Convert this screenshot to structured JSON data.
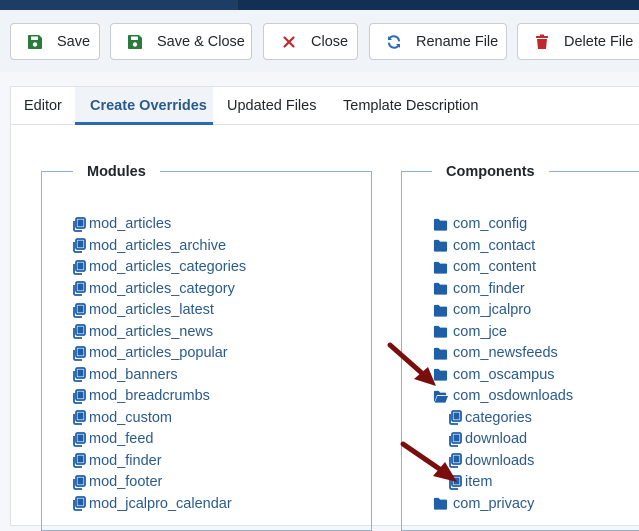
{
  "toolbar": {
    "save": "Save",
    "save_close": "Save & Close",
    "close": "Close",
    "rename": "Rename File",
    "delete": "Delete File"
  },
  "tabs": [
    "Editor",
    "Create Overrides",
    "Updated Files",
    "Template Description"
  ],
  "modules": {
    "title": "Modules",
    "items": [
      "mod_articles",
      "mod_articles_archive",
      "mod_articles_categories",
      "mod_articles_category",
      "mod_articles_latest",
      "mod_articles_news",
      "mod_articles_popular",
      "mod_banners",
      "mod_breadcrumbs",
      "mod_custom",
      "mod_feed",
      "mod_finder",
      "mod_footer",
      "mod_jcalpro_calendar"
    ]
  },
  "components": {
    "title": "Components",
    "items": [
      {
        "label": "com_config",
        "type": "folder"
      },
      {
        "label": "com_contact",
        "type": "folder"
      },
      {
        "label": "com_content",
        "type": "folder"
      },
      {
        "label": "com_finder",
        "type": "folder"
      },
      {
        "label": "com_jcalpro",
        "type": "folder"
      },
      {
        "label": "com_jce",
        "type": "folder"
      },
      {
        "label": "com_newsfeeds",
        "type": "folder"
      },
      {
        "label": "com_oscampus",
        "type": "folder"
      },
      {
        "label": "com_osdownloads",
        "type": "folder-open"
      },
      {
        "label": "categories",
        "type": "file"
      },
      {
        "label": "download",
        "type": "file"
      },
      {
        "label": "downloads",
        "type": "file"
      },
      {
        "label": "item",
        "type": "file"
      },
      {
        "label": "com_privacy",
        "type": "folder"
      }
    ]
  },
  "colors": {
    "link": "#2a5a8c",
    "icon": "#1f5fa8",
    "save_icon": "#2a7a3c",
    "close_icon": "#c0282d",
    "rename_icon": "#2a69b8",
    "delete_icon": "#c0282d",
    "arrow": "#7a0e0e"
  },
  "icons": {
    "save": "floppy-disk-icon",
    "close": "x-icon",
    "rename": "refresh-icon",
    "delete": "trash-icon",
    "module": "copy-icon",
    "folder": "folder-icon",
    "file": "file-copy-icon"
  }
}
